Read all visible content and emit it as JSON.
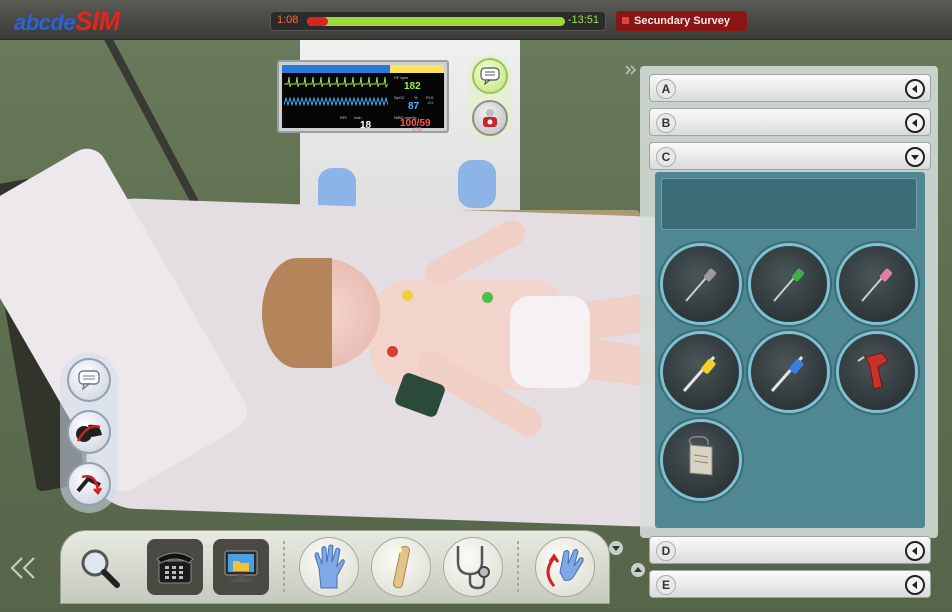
{
  "app": {
    "logo_part1": "abcde",
    "logo_part2": "SIM"
  },
  "timer": {
    "elapsed": "1:08",
    "remaining": "-13:51",
    "progress": 0.08
  },
  "phase": {
    "label": "Secundary Survey"
  },
  "monitor": {
    "hr_label": "HF bpm",
    "hr_value": "182",
    "spo2_label": "SpO2",
    "spo2_unit": "%",
    "spo2_pr": "PLS",
    "spo2_small": "181",
    "spo2_value": "87",
    "rr_label": "RPI",
    "rr_unit": "/min",
    "rr_value": "18",
    "nibp_label": "NIBD mmHg",
    "nibp_value": "100/59",
    "nibp_mean": "(73)",
    "colors": {
      "hr": "#9cf04a",
      "spo2": "#4fb6ff",
      "rr": "#ffffff",
      "nibp": "#ff5a4a"
    }
  },
  "quick_actions": [
    {
      "icon": "speech-bubble-icon"
    },
    {
      "icon": "oxygen-mask-icon"
    }
  ],
  "left_actions": [
    {
      "icon": "speech-bubble-icon"
    },
    {
      "icon": "head-tilt-icon"
    },
    {
      "icon": "reposition-patient-icon"
    }
  ],
  "toolbar": {
    "tools": [
      {
        "icon": "magnifier-icon"
      },
      {
        "icon": "telephone-icon"
      },
      {
        "icon": "patient-file-icon"
      },
      {
        "icon": "glove-icon"
      },
      {
        "icon": "penlight-icon"
      },
      {
        "icon": "stethoscope-icon"
      },
      {
        "icon": "hand-touch-icon"
      }
    ]
  },
  "panel": {
    "sections": [
      {
        "letter": "A",
        "state": "collapsed"
      },
      {
        "letter": "B",
        "state": "collapsed"
      },
      {
        "letter": "C",
        "state": "expanded"
      },
      {
        "letter": "D",
        "state": "collapsed"
      },
      {
        "letter": "E",
        "state": "collapsed"
      }
    ],
    "c_items": [
      {
        "icon": "iv-catheter-grey-icon",
        "accent": "#9a9a9a"
      },
      {
        "icon": "iv-catheter-green-icon",
        "accent": "#3fae4a"
      },
      {
        "icon": "iv-catheter-pink-icon",
        "accent": "#e27fa6"
      },
      {
        "icon": "iv-catheter-yellow-icon",
        "accent": "#f1d22a"
      },
      {
        "icon": "iv-catheter-blue-icon",
        "accent": "#3b7ce0"
      },
      {
        "icon": "intraosseous-drill-icon",
        "accent": "#c8322a"
      },
      {
        "icon": "fluid-bag-icon",
        "accent": "#d8d2c4"
      }
    ]
  }
}
